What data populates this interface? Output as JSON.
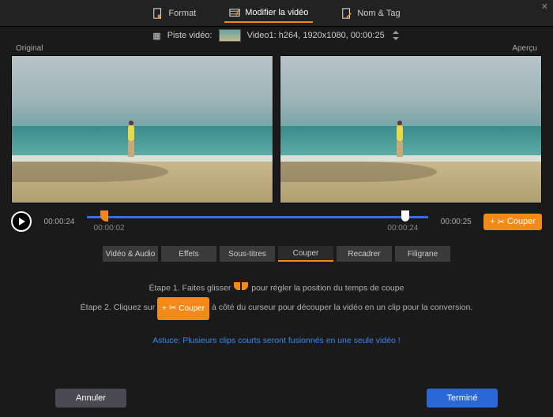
{
  "topTabs": {
    "format": "Format",
    "modify": "Modifier la vidéo",
    "nameTag": "Nom & Tag"
  },
  "track": {
    "label": "Piste vidéo:",
    "info": "Video1: h264, 1920x1080, 00:00:25"
  },
  "previewLabels": {
    "original": "Original",
    "preview": "Aperçu"
  },
  "timeline": {
    "current": "00:00:24",
    "total": "00:00:25",
    "cutStart": "00:00:02",
    "cutEnd": "00:00:24",
    "cutButton": "Couper"
  },
  "subTabs": {
    "videoAudio": "Vidéo  & Audio",
    "effects": "Effets",
    "subtitles": "Sous-titres",
    "cut": "Couper",
    "crop": "Recadrer",
    "watermark": "Filigrane"
  },
  "steps": {
    "line1a": "Étape 1. Faites glisser",
    "line1b": "pour régler la position du temps de coupe",
    "line2a": "Étape 2. Cliquez sur",
    "line2btn": "Couper",
    "line2b": "à côté du curseur pour découper la vidéo en un clip pour la conversion."
  },
  "tip": "Astuce: Plusieurs clips courts seront fusionnés en une seule vidéo !",
  "buttons": {
    "cancel": "Annuler",
    "done": "Terminé"
  }
}
